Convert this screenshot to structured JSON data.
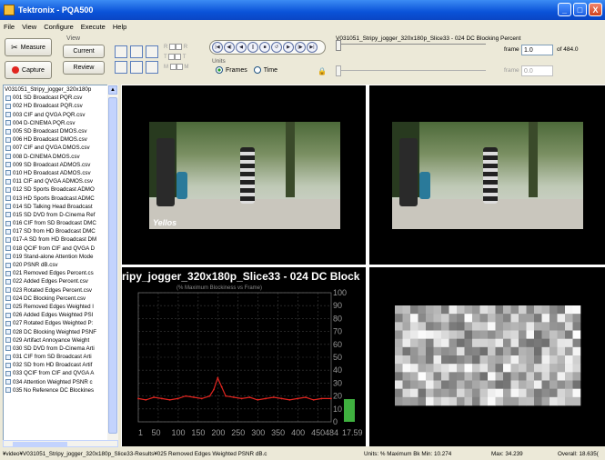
{
  "window": {
    "title": "Tektronix - PQA500",
    "min": "_",
    "max": "□",
    "close": "X"
  },
  "menu": [
    "File",
    "View",
    "Configure",
    "Execute",
    "Help"
  ],
  "toolbar": {
    "measure_label": "Measure",
    "capture_label": "Capture",
    "view_label": "View",
    "current_label": "Current",
    "review_label": "Review",
    "channel_labels": [
      "R",
      "R",
      "T",
      "T",
      "M",
      "M"
    ],
    "units_label": "Units",
    "frames_label": "Frames",
    "time_label": "Time",
    "clip_title": "V031051_Stripy_jogger_320x180p_Slice33 - 024 DC Blocking Percent",
    "frame_label": "frame",
    "frame_value": "1.0",
    "of_label": "of 484.0",
    "frame2_label": "frame",
    "frame2_value": "0.0"
  },
  "filelist": {
    "header": "V031051_Stripy_jogger_320x180p",
    "items": [
      "001 SD Broadcast PQR.csv",
      "002 HD Broadcast PQR.csv",
      "003 CIF and QVGA PQR.csv",
      "004 D-CINEMA PQR.csv",
      "005 SD Broadcast DMOS.csv",
      "006 HD Broadcast DMOS.csv",
      "007 CIF and QVGA DMOS.csv",
      "008 D-CINEMA DMOS.csv",
      "009 SD Broadcast ADMOS.csv",
      "010 HD Broadcast ADMOS.csv",
      "011 CIF and QVGA ADMOS.csv",
      "012 SD Sports Broadcast ADMO",
      "013 HD Sports Broadcast ADMC",
      "014 SD Talking Head Broadcast",
      "015 SD DVD from D-Cinema Ref",
      "016 CIF from SD Broadcast DMC",
      "017 SD from HD Broadcast DMC",
      "017-A SD from HD Broadcast DM",
      "018 QCIF from CIF and QVGA D",
      "019 Stand-alone Attention Mode",
      "020 PSNR dB.csv",
      "021 Removed Edges Percent.cs",
      "022 Added Edges Percent.csv",
      "023 Rotated Edges Percent.csv",
      "024 DC Blocking Percent.csv",
      "025 Removed Edges Weighted I",
      "026 Added Edges Weighted PSI",
      "027 Rotated Edges Weighted P:",
      "028 DC Blocking Weighted PSNF",
      "029 Artifact Annoyance Weight",
      "030 SD DVD from D-Cinema Arti",
      "031 CIF from SD Broadcast Arti",
      "032 SD from HD Broadcast Artif",
      "033 QCIF from CIF and QVGA A",
      "034 Attention Weighted PSNR c",
      "035 No Reference DC Blockines"
    ]
  },
  "video_watermark": "Yellos",
  "chart_title": "ripy_jogger_320x180p_Slice33 - 024 DC Block",
  "chart_subtitle": "(% Maximum Blockiness vs Frame)",
  "chart_data": {
    "type": "line",
    "title": "ripy_jogger_320x180p_Slice33 - 024 DC Block",
    "subtitle": "(% Maximum Blockiness vs Frame)",
    "xlim": [
      1,
      484
    ],
    "ylim": [
      0,
      100
    ],
    "x_ticks": [
      "1",
      "50",
      "100",
      "150",
      "200",
      "250",
      "300",
      "350",
      "400",
      "450",
      "484"
    ],
    "y_ticks": [
      "100",
      "90",
      "80",
      "70",
      "60",
      "50",
      "40",
      "30",
      "20",
      "10",
      "0"
    ],
    "series": [
      {
        "color": "#e0251f",
        "x": [
          1,
          20,
          40,
          60,
          80,
          100,
          120,
          140,
          160,
          180,
          190,
          200,
          210,
          220,
          240,
          260,
          280,
          300,
          320,
          340,
          360,
          380,
          400,
          420,
          440,
          460,
          484
        ],
        "y": [
          18,
          17,
          19,
          18,
          17,
          18,
          20,
          19,
          18,
          20,
          25,
          34,
          27,
          20,
          19,
          18,
          19,
          17,
          18,
          19,
          18,
          17,
          18,
          19,
          17,
          18,
          18
        ]
      }
    ],
    "bar_value": 17.59,
    "bar_color": "#3fb13f",
    "bar_label": "17.59"
  },
  "status": {
    "path": "¥video¥V031051_Stripy_jogger_320x180p_Slice33-Results¥025 Removed Edges Weighted PSNR dB.c",
    "units": "Units: % Maximum Bk Min: 10.274",
    "max": "Max: 34.239",
    "overall": "Overall: 18.635("
  }
}
